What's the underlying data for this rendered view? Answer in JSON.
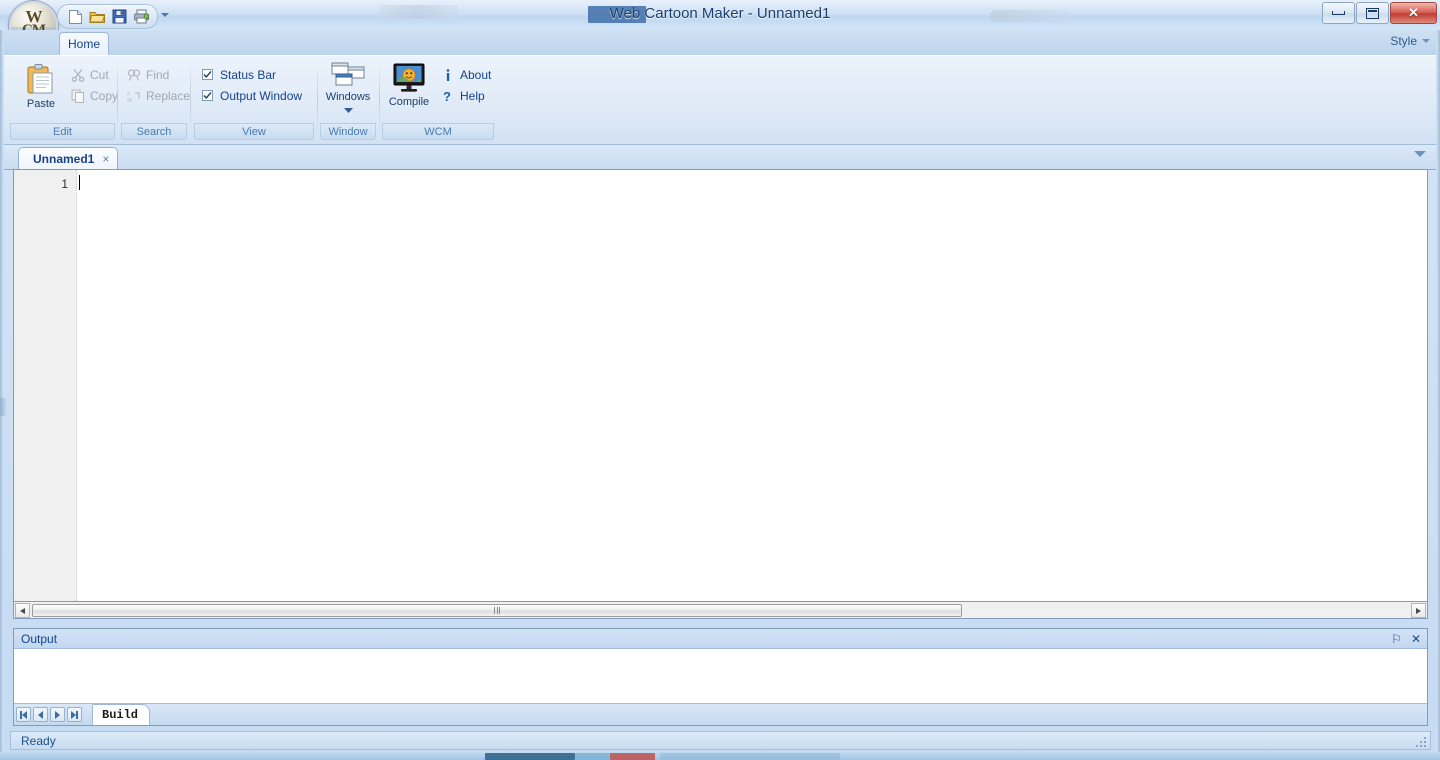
{
  "window": {
    "title": "Web Cartoon Maker - Unnamed1",
    "controls": {
      "minimize": "minimize-button",
      "restore": "restore-button",
      "close": "✕"
    }
  },
  "orb": {
    "top_text": "W",
    "bottom_text": "CM"
  },
  "quick_access": {
    "items": [
      {
        "name": "new-document-icon",
        "label": "New"
      },
      {
        "name": "open-folder-icon",
        "label": "Open"
      },
      {
        "name": "save-icon",
        "label": "Save"
      },
      {
        "name": "print-icon",
        "label": "Print"
      }
    ],
    "overflow_label": "Customize Quick Access Toolbar"
  },
  "ribbon": {
    "tabs": [
      {
        "label": "Home",
        "active": true
      }
    ],
    "style_label": "Style",
    "groups": [
      {
        "label": "Edit",
        "big_button": {
          "label": "Paste",
          "icon": "paste-icon"
        },
        "small_buttons": [
          {
            "label": "Cut",
            "icon": "cut-icon",
            "disabled": true
          },
          {
            "label": "Copy",
            "icon": "copy-icon",
            "disabled": true
          }
        ]
      },
      {
        "label": "Search",
        "small_buttons": [
          {
            "label": "Find",
            "icon": "find-icon",
            "disabled": true
          },
          {
            "label": "Replace",
            "icon": "replace-icon",
            "disabled": true
          }
        ]
      },
      {
        "label": "View",
        "checkboxes": [
          {
            "label": "Status Bar",
            "checked": true
          },
          {
            "label": "Output Window",
            "checked": true
          }
        ]
      },
      {
        "label": "Window",
        "big_button": {
          "label": "Windows",
          "icon": "windows-tile-icon",
          "has_menu": true
        }
      },
      {
        "label": "WCM",
        "big_button": {
          "label": "Compile",
          "icon": "compile-monitor-icon"
        },
        "small_buttons": [
          {
            "label": "About",
            "icon": "info-icon",
            "disabled": false
          },
          {
            "label": "Help",
            "icon": "question-icon",
            "disabled": false
          }
        ]
      }
    ]
  },
  "document_tabs": {
    "items": [
      {
        "label": "Unnamed1",
        "close": "×",
        "active": true
      }
    ],
    "overflow": "chevron-down-icon"
  },
  "editor": {
    "line_numbers": [
      "1"
    ],
    "content": ""
  },
  "output_panel": {
    "title": "Output",
    "tools": [
      {
        "name": "pin-icon",
        "glyph": "⚐"
      },
      {
        "name": "close-icon",
        "glyph": "✕"
      }
    ],
    "nav_buttons": [
      "first",
      "previous",
      "next",
      "last"
    ],
    "tabs": [
      {
        "label": "Build",
        "active": true
      }
    ],
    "body_text": ""
  },
  "status_bar": {
    "text": "Ready"
  },
  "colors": {
    "accent": "#15428b",
    "ribbon_bg": "#dfeaf7",
    "titlebar": "#cfe1f5",
    "close_button": "#c03d33",
    "editor_bg": "#ffffff",
    "gutter_bg": "#f0f0f0"
  }
}
